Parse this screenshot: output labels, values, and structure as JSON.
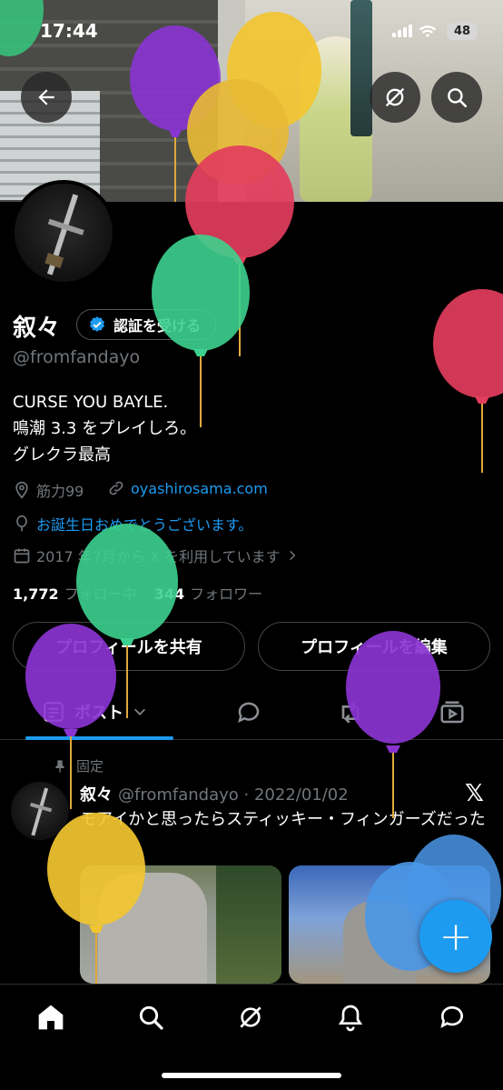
{
  "status_bar": {
    "time": "17:44",
    "battery": "48"
  },
  "profile": {
    "name": "叙々",
    "verify_button": "認証を受ける",
    "handle": "@fromfandayo",
    "bio": [
      "CURSE YOU BAYLE.",
      "鳴潮 3.3 をプレイしろ。",
      "グレクラ最高"
    ],
    "location": "筋力99",
    "website": "oyashirosama.com",
    "birthday": "お誕生日おめでとうございます。",
    "joined": "2017 年7月から X を利用しています",
    "following_count": "1,772",
    "following_label": "フォロー中",
    "followers_count": "344",
    "followers_label": "フォロワー",
    "share_button": "プロフィールを共有",
    "edit_button": "プロフィールを編集"
  },
  "tabs": {
    "posts_label": "ポスト"
  },
  "tweet": {
    "pinned_label": "固定",
    "name": "叙々",
    "handle": "@fromfandayo",
    "date": "2022/01/02",
    "text": "モアイかと思ったらスティッキー・フィンガーズだった"
  },
  "fab_label": "+",
  "colors": {
    "accent": "#1d9bf0",
    "background": "#000000",
    "secondary_text": "#71767b"
  },
  "icons": [
    "back-arrow-icon",
    "grok-icon",
    "search-icon",
    "verified-badge-icon",
    "location-icon",
    "link-icon",
    "balloon-icon",
    "calendar-icon",
    "chevron-right-icon",
    "posts-icon",
    "chevron-down-icon",
    "reply-icon",
    "repost-icon",
    "media-icon",
    "pin-icon",
    "x-logo-icon",
    "home-icon",
    "grok-nav-icon",
    "notifications-icon",
    "messages-icon"
  ]
}
